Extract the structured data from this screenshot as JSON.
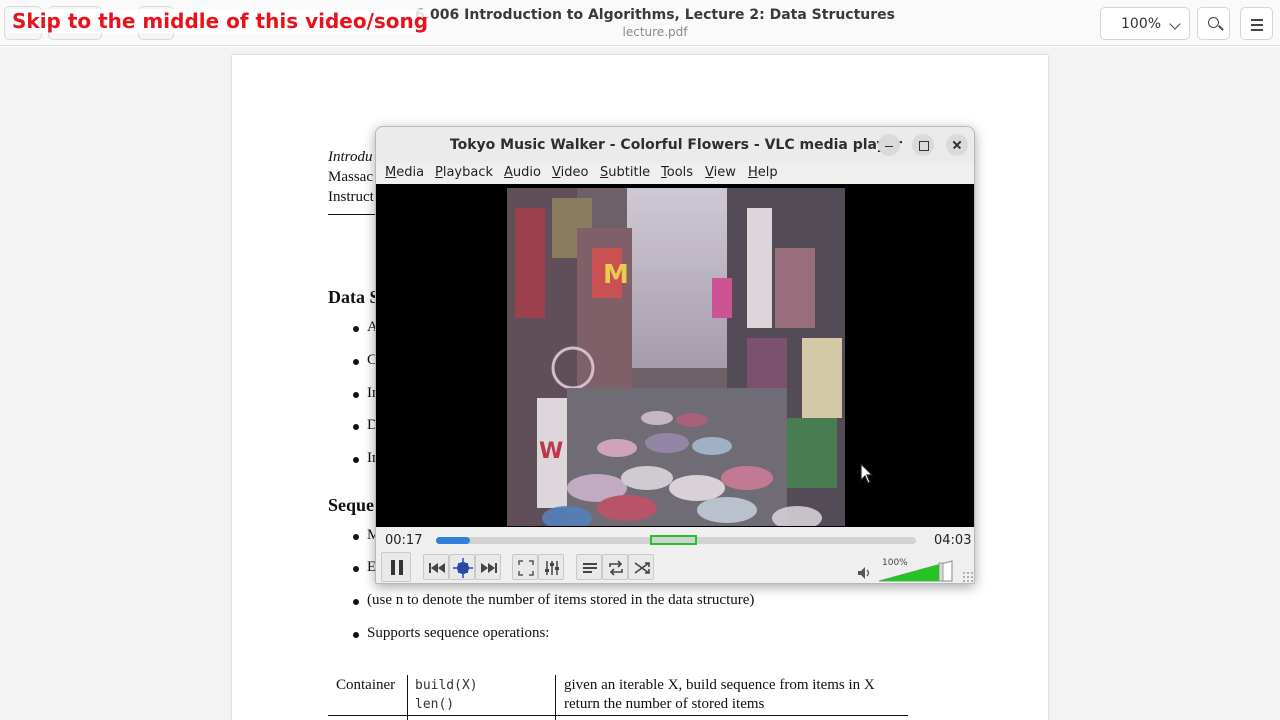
{
  "overlay": {
    "instruction": "Skip to the middle of this video/song"
  },
  "viewer": {
    "title": "6.006 Introduction to Algorithms, Lecture 2: Data Structures",
    "filename": "lecture.pdf",
    "zoom": "100%"
  },
  "document": {
    "intro_lines": [
      "Introdu",
      "Massac",
      "Instruct"
    ],
    "heading_data": "Data S",
    "data_bullets": [
      "A",
      "C",
      "In",
      "D",
      "In"
    ],
    "heading_sequence": "Seque",
    "sequence_bullets": [
      "M",
      "E",
      "(use n to denote the number of items stored in the data structure)",
      "Supports sequence operations:"
    ],
    "table": {
      "row_label": "Container",
      "ops": [
        "build(X)",
        "len()"
      ],
      "descriptions": [
        "given an iterable X, build sequence from items in X",
        "return the number of stored items"
      ]
    }
  },
  "vlc": {
    "title": "Tokyo Music Walker - Colorful Flowers - VLC media player",
    "menu": [
      "Media",
      "Playback",
      "Audio",
      "Video",
      "Subtitle",
      "Tools",
      "View",
      "Help"
    ],
    "elapsed": "00:17",
    "duration": "04:03",
    "progress_fraction": 0.07,
    "volume_label": "100%",
    "volume_fraction": 1.0,
    "colors": {
      "progress": "#2f80d8",
      "volume": "#22c522",
      "ab_loop": "#21c521"
    }
  }
}
